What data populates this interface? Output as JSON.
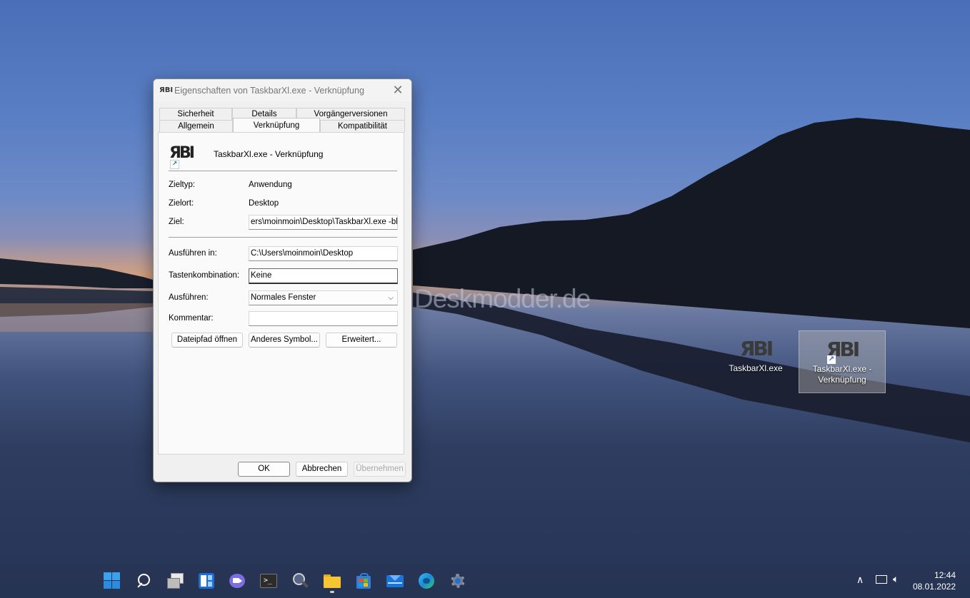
{
  "desktop": {
    "watermark": "Deskmodder.de",
    "icons": [
      {
        "label": "TaskbarXl.exe",
        "logo": "ЯBI"
      },
      {
        "label": "TaskbarXl.exe - Verknüpfung",
        "logo": "ЯBI"
      }
    ]
  },
  "dialog": {
    "title": "Eigenschaften von TaskbarXl.exe - Verknüpfung",
    "title_icon": "ЯBI",
    "tabs_back": [
      "Sicherheit",
      "Details",
      "Vorgängerversionen"
    ],
    "tabs_front": [
      "Allgemein",
      "Verknüpfung",
      "Kompatibilität"
    ],
    "shortcut_name": "TaskbarXl.exe - Verknüpfung",
    "icon_text": "ЯBI",
    "fields": {
      "zieltyp_label": "Zieltyp:",
      "zieltyp_value": "Anwendung",
      "zielort_label": "Zielort:",
      "zielort_value": "Desktop",
      "ziel_label": "Ziel:",
      "ziel_value": "ers\\moinmoin\\Desktop\\TaskbarXl.exe -blur",
      "ausfuehren_in_label": "Ausführen in:",
      "ausfuehren_in_value": "C:\\Users\\moinmoin\\Desktop",
      "tastenkombination_label": "Tastenkombination:",
      "tastenkombination_value": "Keine",
      "ausfuehren_label": "Ausführen:",
      "ausfuehren_value": "Normales Fenster",
      "kommentar_label": "Kommentar:",
      "kommentar_value": ""
    },
    "buttons": {
      "open_path": "Dateipfad öffnen",
      "change_icon": "Anderes Symbol...",
      "advanced": "Erweitert...",
      "ok": "OK",
      "cancel": "Abbrechen",
      "apply": "Übernehmen"
    }
  },
  "taskbar": {
    "icons": [
      "start-icon",
      "search-icon",
      "task-view-icon",
      "widgets-icon",
      "chat-icon",
      "terminal-icon",
      "magnifier-icon",
      "file-explorer-icon",
      "store-icon",
      "mail-icon",
      "edge-icon",
      "settings-icon"
    ],
    "clock": {
      "time": "12:44",
      "date": "08.01.2022"
    }
  }
}
